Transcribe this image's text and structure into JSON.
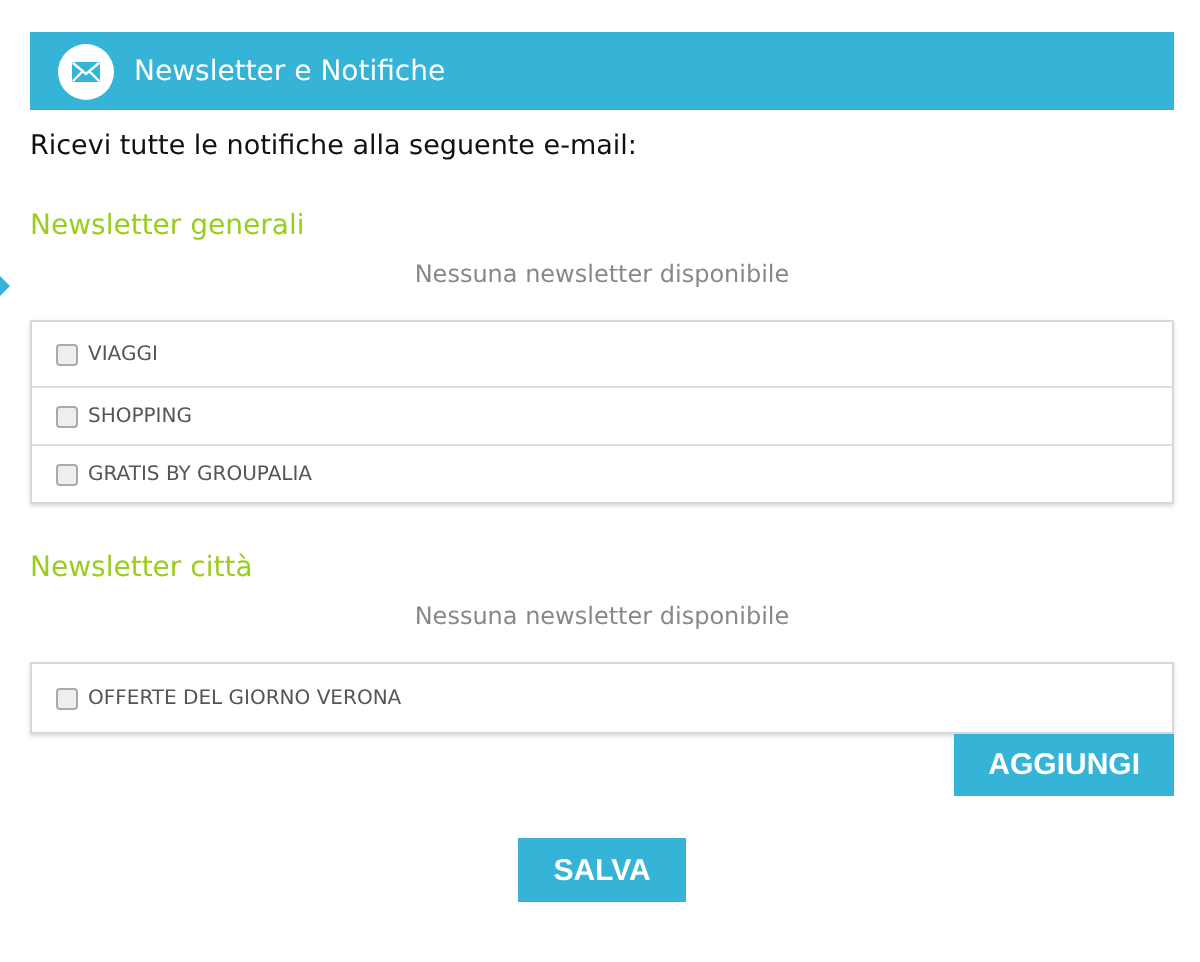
{
  "header": {
    "title": "Newsletter e Notifiche"
  },
  "email_notice": "Ricevi tutte le notifiche alla seguente e-mail:",
  "sections": [
    {
      "title": "Newsletter generali",
      "empty_message": "Nessuna newsletter disponibile",
      "items": [
        {
          "label": "VIAGGI",
          "checked": false
        },
        {
          "label": "SHOPPING",
          "checked": false
        },
        {
          "label": "GRATIS BY GROUPALIA",
          "checked": false
        }
      ]
    },
    {
      "title": "Newsletter città",
      "empty_message": "Nessuna newsletter disponibile",
      "items": [
        {
          "label": "OFFERTE DEL GIORNO VERONA",
          "checked": false
        }
      ],
      "add_button": "AGGIUNGI"
    }
  ],
  "save_button": "SALVA"
}
